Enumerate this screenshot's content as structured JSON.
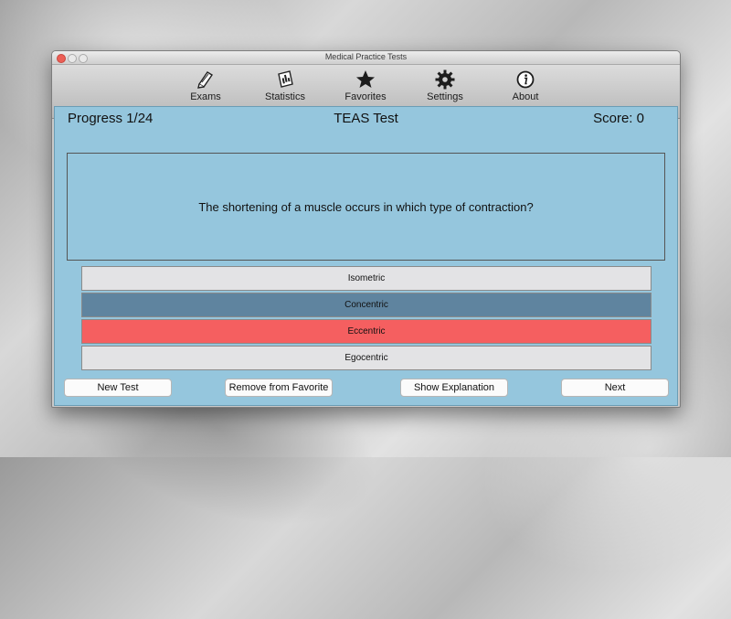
{
  "window": {
    "title": "Medical Practice Tests"
  },
  "toolbar": {
    "items": [
      {
        "label": "Exams",
        "icon": "exams-icon"
      },
      {
        "label": "Statistics",
        "icon": "statistics-icon"
      },
      {
        "label": "Favorites",
        "icon": "star-icon"
      },
      {
        "label": "Settings",
        "icon": "gear-icon"
      },
      {
        "label": "About",
        "icon": "info-icon"
      }
    ]
  },
  "header": {
    "progress": "Progress 1/24",
    "test_title": "TEAS Test",
    "score": "Score: 0"
  },
  "question": {
    "text": "The shortening of a muscle occurs in which type of contraction?"
  },
  "answers": [
    {
      "label": "Isometric",
      "state": "normal"
    },
    {
      "label": "Concentric",
      "state": "selected"
    },
    {
      "label": "Eccentric",
      "state": "wrong"
    },
    {
      "label": "Egocentric",
      "state": "normal"
    }
  ],
  "buttons": {
    "new_test": "New Test",
    "remove_favorite": "Remove from Favorite",
    "show_explanation": "Show Explanation",
    "next": "Next"
  },
  "colors": {
    "content_bg": "#95c6dd",
    "selected_answer": "#5f849f",
    "wrong_answer": "#f55f60",
    "answer_bg": "#e3e3e5"
  }
}
